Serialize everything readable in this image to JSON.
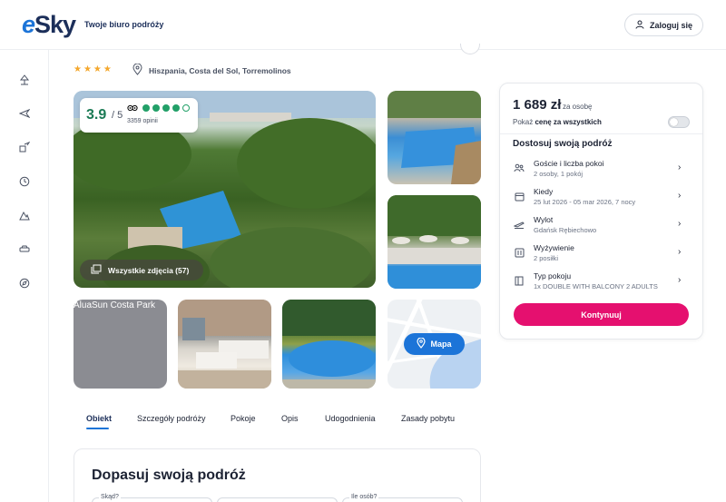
{
  "header": {
    "logo_e": "e",
    "logo_sky": "Sky",
    "tagline": "Twoje biuro podróży",
    "login_label": "Zaloguj się"
  },
  "sidebar": {
    "icons": [
      "beach-icon",
      "plane-icon",
      "hotel-plane-icon",
      "clock-icon",
      "mountain-icon",
      "car-icon",
      "compass-icon"
    ]
  },
  "hotel": {
    "stars": "★★★★",
    "location": "Hiszpania, Costa del Sol, Torremolinos"
  },
  "rating": {
    "score": "3.9",
    "out_of": "/ 5",
    "reviews": "3359 opinii",
    "bubbles_filled": 4,
    "bubbles_total": 5
  },
  "gallery": {
    "all_photos_label": "Wszystkie zdjęcia (57)",
    "broken_image_alt": "AluaSun Costa Park",
    "map_label": "Mapa"
  },
  "tabs": [
    "Obiekt",
    "Szczegóły podróży",
    "Pokoje",
    "Opis",
    "Udogodnienia",
    "Zasady pobytu"
  ],
  "adjust": {
    "title": "Dopasuj swoją podróż",
    "field1_label": "Skąd?",
    "field3_label": "Ile osób?"
  },
  "panel": {
    "price": "1 689 zł",
    "price_per": "za osobę",
    "toggle_text_prefix": "Pokaż ",
    "toggle_text_bold": "cenę za wszystkich",
    "customize_title": "Dostosuj swoją podróż",
    "options": [
      {
        "title": "Goście i liczba pokoi",
        "sub": "2 osoby, 1 pokój",
        "icon": "guests-icon"
      },
      {
        "title": "Kiedy",
        "sub": "25 lut 2026 - 05 mar 2026, 7 nocy",
        "icon": "calendar-icon"
      },
      {
        "title": "Wylot",
        "sub": "Gdańsk Rębiechowo",
        "icon": "departure-icon"
      },
      {
        "title": "Wyżywienie",
        "sub": "2 posiłki",
        "icon": "meal-icon"
      },
      {
        "title": "Typ pokoju",
        "sub": "1x DOUBLE WITH BALCONY 2 ADULTS",
        "icon": "room-icon"
      }
    ],
    "continue_label": "Kontynuuj"
  },
  "colors": {
    "brand_blue": "#1c74d8",
    "brand_navy": "#1c2f5a",
    "cta_pink": "#e5106f",
    "tripadvisor_green": "#22a068",
    "star_orange": "#f4a72c"
  }
}
